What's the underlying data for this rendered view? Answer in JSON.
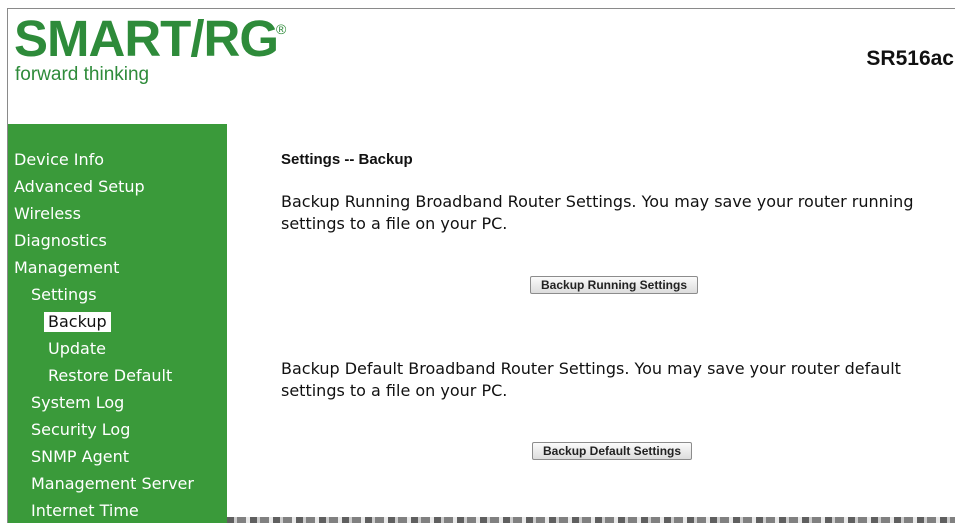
{
  "header": {
    "logo_text": "SMART/RG",
    "logo_registered": "®",
    "tagline": "forward thinking",
    "model": "SR516ac"
  },
  "sidebar": {
    "items": [
      {
        "label": "Device Info"
      },
      {
        "label": "Advanced Setup"
      },
      {
        "label": "Wireless"
      },
      {
        "label": "Diagnostics"
      },
      {
        "label": "Management"
      },
      {
        "label": "Settings"
      },
      {
        "label": "Backup",
        "active": true
      },
      {
        "label": "Update"
      },
      {
        "label": "Restore Default"
      },
      {
        "label": "System Log"
      },
      {
        "label": "Security Log"
      },
      {
        "label": "SNMP Agent"
      },
      {
        "label": "Management Server"
      },
      {
        "label": "Internet Time"
      }
    ]
  },
  "main": {
    "heading": "Settings -- Backup",
    "running_text": "Backup Running Broadband Router Settings. You may save your router running settings to a file on your PC.",
    "running_button": "Backup Running Settings",
    "default_text": "Backup Default Broadband Router Settings. You may save your router default settings to a file on your PC.",
    "default_button": "Backup Default Settings"
  },
  "colors": {
    "brand_green": "#2e8b3a",
    "sidebar_green": "#3a9a3a"
  }
}
